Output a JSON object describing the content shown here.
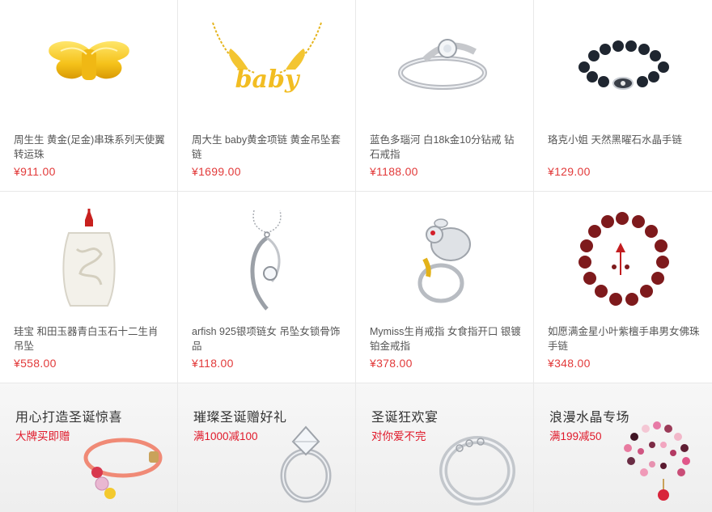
{
  "products": [
    {
      "title": "周生生 黄金(足金)串珠系列天使翼转运珠",
      "price": "¥911.00",
      "image": "gold-wing-charm"
    },
    {
      "title": "周大生 baby黄金项链 黄金吊坠套链",
      "price": "¥1699.00",
      "image": "gold-baby-necklace"
    },
    {
      "title": "蓝色多瑙河 白18k金10分钻戒 钻石戒指",
      "price": "¥1188.00",
      "image": "white-gold-diamond-ring"
    },
    {
      "title": "珞克小姐 天然黑曜石水晶手链",
      "price": "¥129.00",
      "image": "obsidian-bracelet"
    },
    {
      "title": "珪宝 和田玉器青白玉石十二生肖吊坠",
      "price": "¥558.00",
      "image": "jade-pendant"
    },
    {
      "title": "arfish 925银项链女 吊坠女锁骨饰品",
      "price": "¥118.00",
      "image": "silver-pendant-necklace"
    },
    {
      "title": "Mymiss生肖戒指 女食指开口 银镀铂金戒指",
      "price": "¥378.00",
      "image": "rabbit-ring"
    },
    {
      "title": "如愿满金星小叶紫檀手串男女佛珠手链",
      "price": "¥348.00",
      "image": "sandalwood-bead-bracelet"
    }
  ],
  "promos": [
    {
      "title": "用心打造圣诞惊喜",
      "subtitle": "大牌买即赠",
      "image": "beaded-rope-bracelet"
    },
    {
      "title": "璀璨圣诞赠好礼",
      "subtitle": "满1000减100",
      "image": "solitaire-ring"
    },
    {
      "title": "圣诞狂欢宴",
      "subtitle": "对你爱不完",
      "image": "silver-bangle"
    },
    {
      "title": "浪漫水晶专场",
      "subtitle": "满199减50",
      "image": "tourmaline-crystal-bracelet"
    }
  ],
  "colors": {
    "price": "#e23a3a",
    "promo_sub": "#e0192a",
    "border": "#e8e8e8"
  }
}
